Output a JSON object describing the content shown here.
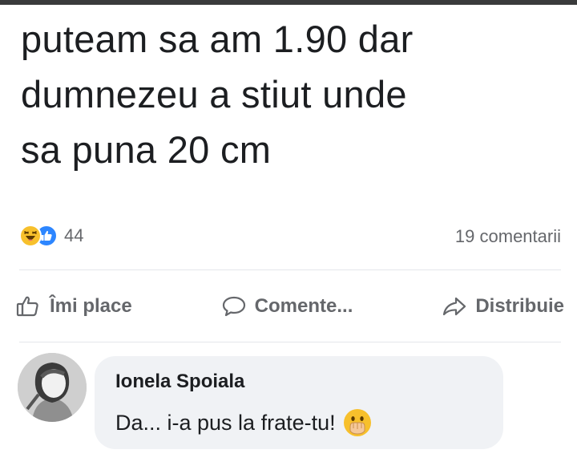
{
  "post": {
    "lines": [
      "puteam sa am 1.90 dar",
      "dumnezeu a stiut unde",
      "sa puna 20 cm"
    ]
  },
  "stats": {
    "reaction_icons": [
      "haha-reaction-icon",
      "like-reaction-icon"
    ],
    "reaction_count": "44",
    "comments": "19 comentarii"
  },
  "actions": {
    "like_label": "Îmi place",
    "comment_label": "Comente...",
    "share_label": "Distribuie"
  },
  "comment": {
    "author": "Ionela Spoiala",
    "text": "Da... i-a pus la frate-tu!",
    "emoji": "hand-over-mouth-emoji"
  },
  "colors": {
    "text": "#1c1e21",
    "secondary": "#65676b",
    "bubble": "#f0f2f5",
    "like_blue": "#2d86ff",
    "haha_yellow": "#f7c02c"
  }
}
